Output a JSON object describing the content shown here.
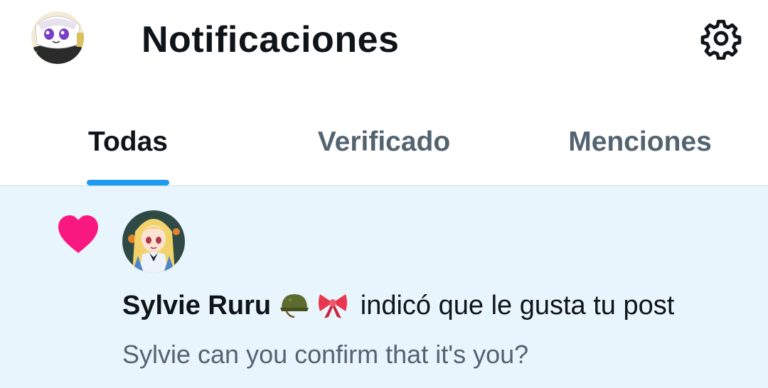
{
  "header": {
    "title": "Notificaciones",
    "avatar_icon": "user-avatar",
    "settings_icon": "gear-icon"
  },
  "tabs": [
    {
      "label": "Todas",
      "active": true
    },
    {
      "label": "Verificado",
      "active": false
    },
    {
      "label": "Menciones",
      "active": false
    }
  ],
  "notification": {
    "type_icon": "heart-icon",
    "type_color": "#f91880",
    "user_name": "Sylvie Ruru",
    "name_emojis": [
      "military-helmet-emoji",
      "ribbon-emoji"
    ],
    "action_text": "indicó que le gusta tu post",
    "preview_text": "Sylvie can you confirm that it's you?"
  },
  "colors": {
    "accent": "#1d9bf0",
    "notification_bg": "#e8f5fc",
    "secondary_text": "#536471",
    "primary_text": "#0f1419"
  }
}
